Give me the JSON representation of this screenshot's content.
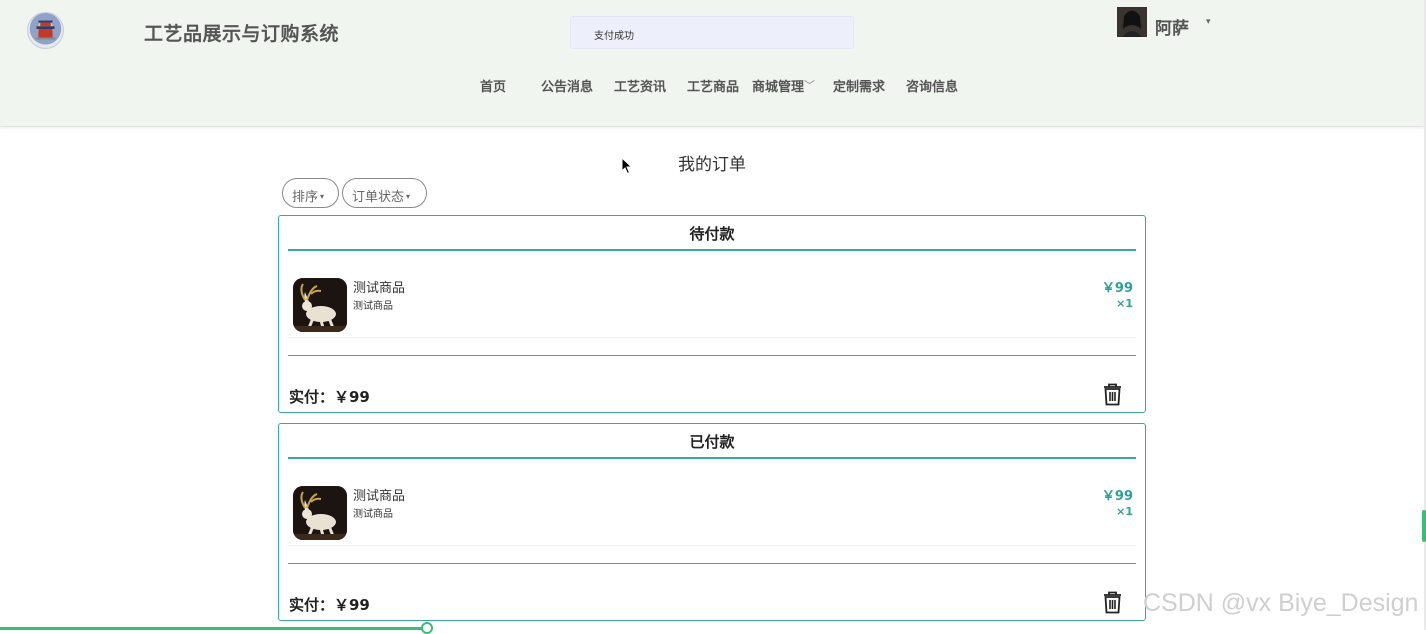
{
  "header": {
    "site_title": "工艺品展示与订购系统",
    "toast": "支付成功",
    "user_name": "阿萨",
    "user_caret": "▾"
  },
  "nav": {
    "home": "首页",
    "notices": "公告消息",
    "news": "工艺资讯",
    "products": "工艺商品",
    "mall": "商城管理",
    "mall_chevron": "﹀",
    "custom": "定制需求",
    "consult": "咨询信息"
  },
  "page": {
    "title": "我的订单",
    "sort_label": "排序",
    "status_filter_label": "订单状态",
    "caret": "▾"
  },
  "orders": [
    {
      "status": "待付款",
      "product_name": "测试商品",
      "product_sub": "测试商品",
      "price": "￥99",
      "qty": "×1",
      "paid_text": "实付：￥99"
    },
    {
      "status": "已付款",
      "product_name": "测试商品",
      "product_sub": "测试商品",
      "price": "￥99",
      "qty": "×1",
      "paid_text": "实付：￥99"
    }
  ],
  "watermark": "CSDN @vx Biye_Design",
  "colors": {
    "accent": "#3aa6a6",
    "price": "#2aa19a",
    "header_bg": "#f0f5ef",
    "toast_bg": "#edf0fa",
    "progress": "#3bbd7a"
  },
  "icons": [
    "logo-icon",
    "avatar",
    "chevron-down-icon",
    "caret-down-icon",
    "trash-icon",
    "cursor-icon"
  ]
}
